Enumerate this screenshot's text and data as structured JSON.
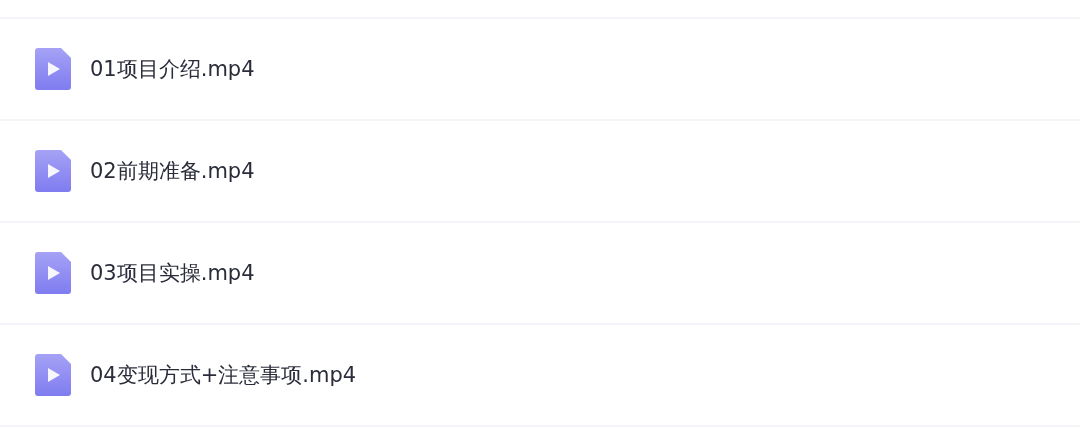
{
  "files": [
    {
      "name": "01项目介绍.mp4"
    },
    {
      "name": "02前期准备.mp4"
    },
    {
      "name": "03项目实操.mp4"
    },
    {
      "name": "04变现方式+注意事项.mp4"
    }
  ]
}
